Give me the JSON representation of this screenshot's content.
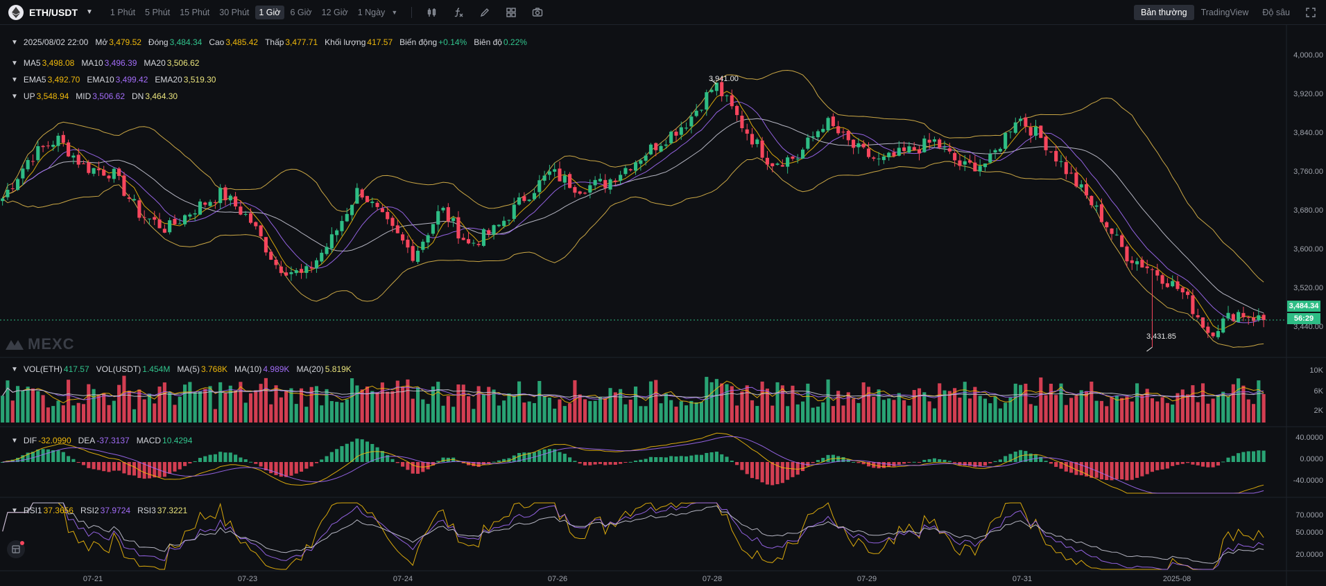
{
  "header": {
    "pair": "ETH/USDT",
    "intervals": [
      "1 Phút",
      "5 Phút",
      "15 Phút",
      "30 Phút",
      "1 Giờ",
      "6 Giờ",
      "12 Giờ",
      "1 Ngày"
    ],
    "active_interval": "1 Giờ",
    "tools": [
      "indicator-icon",
      "formula-icon",
      "pencil-icon",
      "layout-grid-icon",
      "camera-icon"
    ],
    "views": [
      "Bản thường",
      "TradingView",
      "Độ sâu"
    ],
    "active_view": "Bản thường"
  },
  "ohlc": {
    "datetime": "2025/08/02 22:00",
    "open_label": "Mở",
    "open": "3,479.52",
    "close_label": "Đóng",
    "close": "3,484.34",
    "high_label": "Cao",
    "high": "3,485.42",
    "low_label": "Thấp",
    "low": "3,477.71",
    "volume_label": "Khối lượng",
    "volume": "417.57",
    "change_label": "Biến động",
    "change": "+0.14%",
    "amp_label": "Biên độ",
    "amp": "0.22%"
  },
  "ma": {
    "ma5_label": "MA5",
    "ma5": "3,498.08",
    "ma10_label": "MA10",
    "ma10": "3,496.39",
    "ma20_label": "MA20",
    "ma20": "3,506.62"
  },
  "ema": {
    "ema5_label": "EMA5",
    "ema5": "3,492.70",
    "ema10_label": "EMA10",
    "ema10": "3,499.42",
    "ema20_label": "EMA20",
    "ema20": "3,519.30"
  },
  "boll": {
    "up_label": "UP",
    "up": "3,548.94",
    "mid_label": "MID",
    "mid": "3,506.62",
    "dn_label": "DN",
    "dn": "3,464.30"
  },
  "vol": {
    "eth_label": "VOL(ETH)",
    "eth": "417.57",
    "usdt_label": "VOL(USDT)",
    "usdt": "1.454M",
    "ma5_label": "MA(5)",
    "ma5": "3.768K",
    "ma10_label": "MA(10)",
    "ma10": "4.989K",
    "ma20_label": "MA(20)",
    "ma20": "5.819K"
  },
  "macd": {
    "dif_label": "DIF",
    "dif": "-32.0990",
    "dea_label": "DEA",
    "dea": "-37.3137",
    "macd_label": "MACD",
    "macd": "10.4294"
  },
  "rsi": {
    "rsi1_label": "RSI1",
    "rsi1": "37.3656",
    "rsi2_label": "RSI2",
    "rsi2": "37.9724",
    "rsi3_label": "RSI3",
    "rsi3": "37.3221"
  },
  "price_axis": [
    "4,000.00",
    "3,920.00",
    "3,840.00",
    "3,760.00",
    "3,680.00",
    "3,600.00",
    "3,520.00",
    "3,440.00"
  ],
  "volume_axis": [
    "10K",
    "6K",
    "2K"
  ],
  "macd_axis": [
    "40.0000",
    "0.0000",
    "-40.0000"
  ],
  "rsi_axis": [
    "70.0000",
    "50.0000",
    "20.0000"
  ],
  "date_axis": [
    "07-21",
    "07-23",
    "07-24",
    "07-26",
    "07-28",
    "07-29",
    "07-31",
    "2025-08"
  ],
  "current_price": "3,484.34",
  "countdown": "56:29",
  "high_annotation": "3,941.00",
  "low_annotation": "3,431.85",
  "watermark": "MEXC",
  "colors": {
    "up": "#2ebd85",
    "down": "#f6465d",
    "ma5": "#f0b90b",
    "ma10": "#a26cf7",
    "ma20": "#e9e37c",
    "background": "#0e1014"
  },
  "chart_data": {
    "type": "candlestick",
    "interval": "1 Giờ",
    "price_ylim": [
      3420,
      4010
    ],
    "x": [
      "07-21",
      "07-23",
      "07-24",
      "07-26",
      "07-28",
      "07-29",
      "07-31",
      "2025-08"
    ],
    "price_path": [
      3720,
      3800,
      3835,
      3780,
      3770,
      3690,
      3660,
      3700,
      3730,
      3680,
      3590,
      3570,
      3640,
      3740,
      3670,
      3610,
      3700,
      3630,
      3660,
      3720,
      3770,
      3740,
      3750,
      3790,
      3830,
      3870,
      3941,
      3860,
      3790,
      3800,
      3870,
      3820,
      3790,
      3810,
      3830,
      3780,
      3790,
      3880,
      3830,
      3760,
      3690,
      3610,
      3580,
      3540,
      3460,
      3500,
      3484
    ],
    "volume_ylim": [
      0,
      12000
    ],
    "macd_ylim": [
      -50,
      50
    ],
    "rsi_ylim": [
      10,
      80
    ]
  }
}
